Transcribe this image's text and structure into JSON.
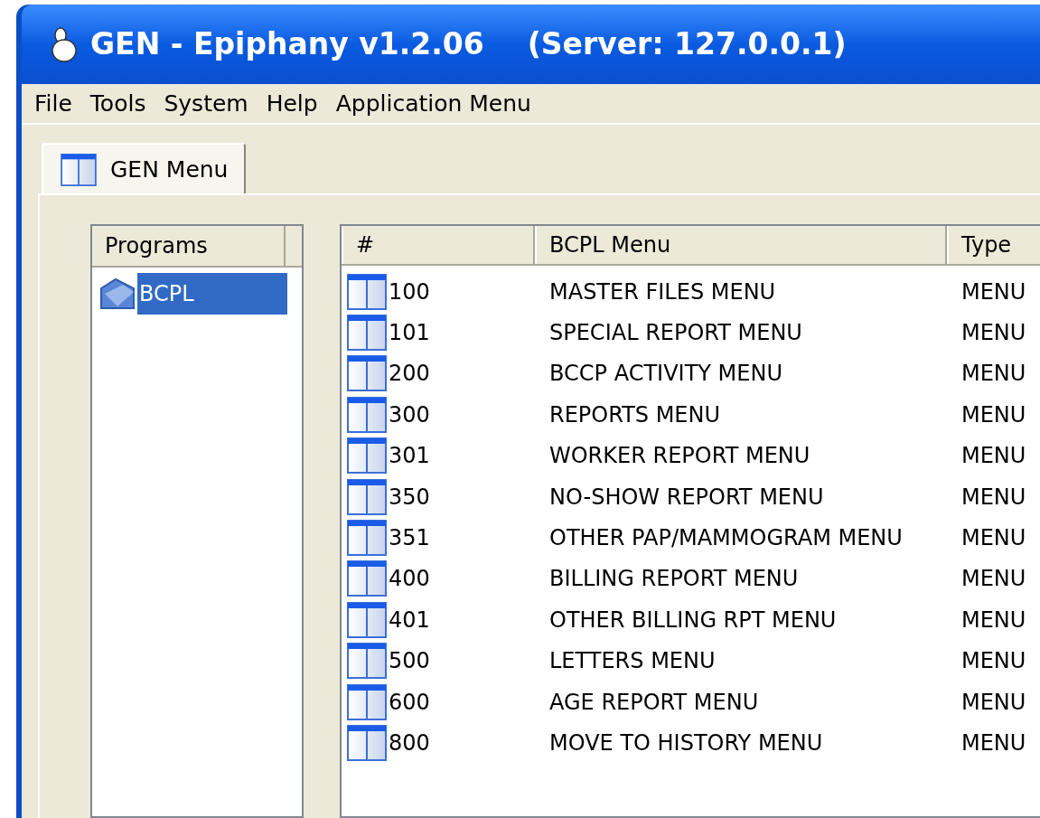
{
  "window": {
    "title": "GEN - Epiphany v1.2.06",
    "server": "(Server: 127.0.0.1)"
  },
  "menu": [
    "File",
    "Tools",
    "System",
    "Help",
    "Application Menu"
  ],
  "tabs": [
    {
      "label": "GEN Menu",
      "selected": true
    }
  ],
  "programs": {
    "column": "Programs",
    "items": [
      {
        "label": "BCPL",
        "selected": true
      }
    ]
  },
  "table": {
    "columns": [
      "#",
      "BCPL Menu",
      "Type"
    ],
    "rows": [
      {
        "number": "100",
        "name": "MASTER FILES MENU",
        "type": "MENU"
      },
      {
        "number": "101",
        "name": "SPECIAL REPORT MENU",
        "type": "MENU"
      },
      {
        "number": "200",
        "name": "BCCP ACTIVITY MENU",
        "type": "MENU"
      },
      {
        "number": "300",
        "name": "REPORTS MENU",
        "type": "MENU"
      },
      {
        "number": "301",
        "name": "WORKER REPORT MENU",
        "type": "MENU"
      },
      {
        "number": "350",
        "name": "NO-SHOW REPORT MENU",
        "type": "MENU"
      },
      {
        "number": "351",
        "name": "OTHER PAP/MAMMOGRAM MENU",
        "type": "MENU"
      },
      {
        "number": "400",
        "name": "BILLING REPORT MENU",
        "type": "MENU"
      },
      {
        "number": "401",
        "name": "OTHER BILLING RPT MENU",
        "type": "MENU"
      },
      {
        "number": "500",
        "name": "LETTERS MENU",
        "type": "MENU"
      },
      {
        "number": "600",
        "name": "AGE REPORT MENU",
        "type": "MENU"
      },
      {
        "number": "800",
        "name": "MOVE TO HISTORY MENU",
        "type": "MENU"
      }
    ]
  }
}
